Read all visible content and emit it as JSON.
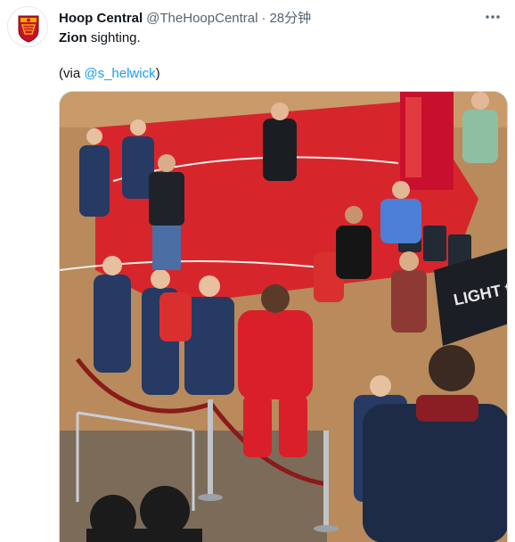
{
  "tweet": {
    "author_name": "Hoop Central",
    "author_handle": "@TheHoopCentral",
    "separator": "·",
    "timestamp": "28分钟",
    "text_bold": "Zion",
    "text_rest": " sighting.",
    "via_prefix": "(via ",
    "via_mention": "@s_helwick",
    "via_suffix": ")",
    "avatar_icon": "hoop-central-logo-icon",
    "more_icon": "more-options-icon",
    "mention_color": "#1d9bf0",
    "court_red": "#d6262c",
    "brand_colors": [
      "#c8102e",
      "#f2a900"
    ],
    "banner_text": "LIGHT the FU"
  }
}
